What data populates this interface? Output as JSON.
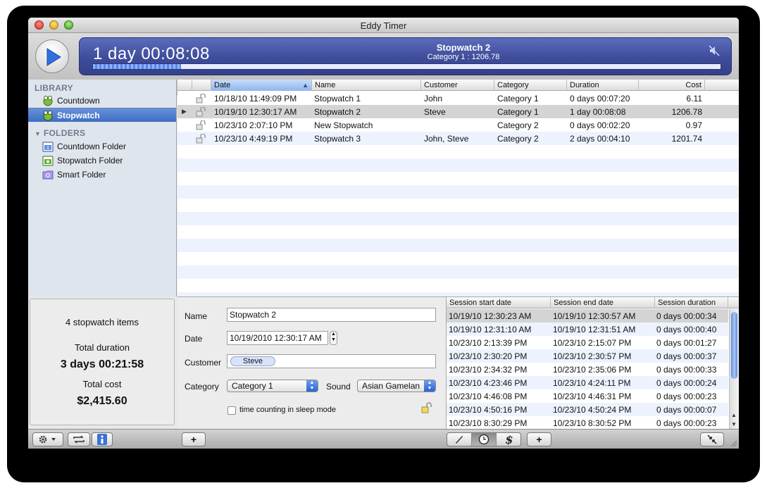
{
  "window": {
    "title": "Eddy Timer"
  },
  "lcd": {
    "time": "1 day 00:08:08",
    "item_name": "Stopwatch 2",
    "item_category": "Category 1 : 1206.78",
    "progress": 0.14
  },
  "sidebar": {
    "library_header": "LIBRARY",
    "library_items": [
      {
        "label": "Countdown",
        "icon": "frog-countdown-icon"
      },
      {
        "label": "Stopwatch",
        "icon": "frog-stopwatch-icon"
      }
    ],
    "folders_header": "FOLDERS",
    "folder_items": [
      {
        "label": "Countdown Folder",
        "icon": "countdown-folder-icon"
      },
      {
        "label": "Stopwatch Folder",
        "icon": "stopwatch-folder-icon"
      },
      {
        "label": "Smart Folder",
        "icon": "smart-folder-icon"
      }
    ]
  },
  "summary": {
    "count": "4 stopwatch items",
    "duration_label": "Total duration",
    "duration_value": "3 days 00:21:58",
    "cost_label": "Total cost",
    "cost_value": "$2,415.60"
  },
  "table": {
    "columns": [
      "Date",
      "Name",
      "Customer",
      "Category",
      "Duration",
      "Cost"
    ],
    "rows": [
      [
        "10/18/10 11:49:09 PM",
        "Stopwatch 1",
        "John",
        "Category 1",
        "0 days 00:07:20",
        "6.11"
      ],
      [
        "10/19/10 12:30:17 AM",
        "Stopwatch 2",
        "Steve",
        "Category 1",
        "1 day 00:08:08",
        "1206.78"
      ],
      [
        "10/23/10 2:07:10 PM",
        "New Stopwatch",
        "",
        "Category 2",
        "0 days 00:02:20",
        "0.97"
      ],
      [
        "10/23/10 4:49:19 PM",
        "Stopwatch 3",
        "John, Steve",
        "Category 2",
        "2 days 00:04:10",
        "1201.74"
      ]
    ],
    "selected_row": 1
  },
  "detail": {
    "name_label": "Name",
    "name_value": "Stopwatch 2",
    "date_label": "Date",
    "date_value": "10/19/2010 12:30:17 AM",
    "customer_label": "Customer",
    "customer_token": "Steve",
    "category_label": "Category",
    "category_value": "Category 1",
    "sound_label": "Sound",
    "sound_value": "Asian Gamelan",
    "sleep_label": "time counting in sleep mode"
  },
  "sessions": {
    "columns": [
      "Session start date",
      "Session end date",
      "Session duration"
    ],
    "rows": [
      [
        "10/19/10 12:30:23 AM",
        "10/19/10 12:30:57 AM",
        "0 days 00:00:34"
      ],
      [
        "10/19/10 12:31:10 AM",
        "10/19/10 12:31:51 AM",
        "0 days 00:00:40"
      ],
      [
        "10/23/10 2:13:39 PM",
        "10/23/10 2:15:07 PM",
        "0 days 00:01:27"
      ],
      [
        "10/23/10 2:30:20 PM",
        "10/23/10 2:30:57 PM",
        "0 days 00:00:37"
      ],
      [
        "10/23/10 2:34:32 PM",
        "10/23/10 2:35:06 PM",
        "0 days 00:00:33"
      ],
      [
        "10/23/10 4:23:46 PM",
        "10/23/10 4:24:11 PM",
        "0 days 00:00:24"
      ],
      [
        "10/23/10 4:46:08 PM",
        "10/23/10 4:46:31 PM",
        "0 days 00:00:23"
      ],
      [
        "10/23/10 4:50:16 PM",
        "10/23/10 4:50:24 PM",
        "0 days 00:00:07"
      ],
      [
        "10/23/10 8:30:29 PM",
        "10/23/10 8:30:52 PM",
        "0 days 00:00:23"
      ]
    ]
  },
  "bottombar": {
    "add_label": "+",
    "add_session_label": "+"
  },
  "colors": {
    "lcd_bg": "#3e4c9a",
    "selection": "#3d6ec6",
    "alt_row": "#edf3fe"
  }
}
